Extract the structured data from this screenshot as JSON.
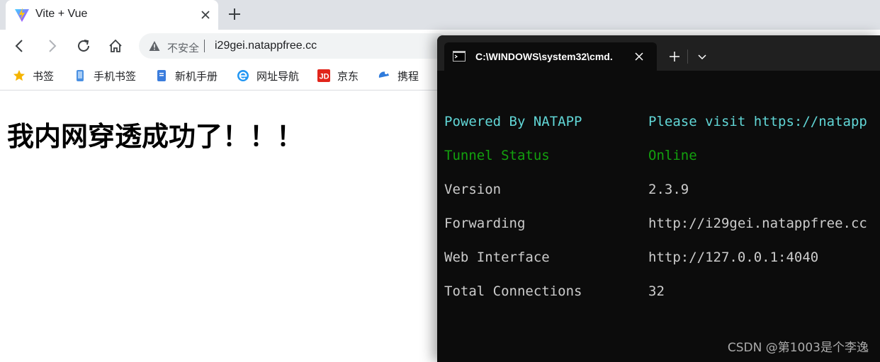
{
  "browser": {
    "tab": {
      "title": "Vite + Vue",
      "favicon": "vite-logo-icon",
      "close_icon": "close-icon"
    },
    "new_tab_icon": "plus-icon",
    "toolbar": {
      "back_icon": "back-arrow-icon",
      "forward_icon": "forward-arrow-icon",
      "reload_icon": "reload-icon",
      "home_icon": "home-icon",
      "security_icon": "warning-triangle-icon",
      "security_label": "不安全",
      "url": "i29gei.natappfree.cc"
    },
    "bookmarks": [
      {
        "label": "书签",
        "icon": "star-icon"
      },
      {
        "label": "手机书签",
        "icon": "phone-icon"
      },
      {
        "label": "新机手册",
        "icon": "manual-icon"
      },
      {
        "label": "网址导航",
        "icon": "browser-e-icon"
      },
      {
        "label": "京东",
        "icon": "jd-icon"
      },
      {
        "label": "携程",
        "icon": "ctrip-icon"
      }
    ],
    "page": {
      "heading": "我内网穿透成功了！！！"
    }
  },
  "terminal": {
    "tab_title": "C:\\WINDOWS\\system32\\cmd.",
    "rows": [
      {
        "key": "Powered By NATAPP",
        "value": "Please visit https://natapp"
      },
      {
        "key": "Tunnel Status",
        "value": "Online"
      },
      {
        "key": "Version",
        "value": "2.3.9"
      },
      {
        "key": "Forwarding",
        "value": "http://i29gei.natappfree.cc"
      },
      {
        "key": "Web Interface",
        "value": "http://127.0.0.1:4040"
      },
      {
        "key": "Total Connections",
        "value": "32"
      }
    ]
  },
  "watermark": "CSDN @第1003是个李逸",
  "colors": {
    "cyan": "#61d6d6",
    "green": "#13a10e",
    "gray_text": "#cccccc",
    "terminal_bg": "#0c0c0c",
    "tabstrip_bg": "#dee1e6"
  }
}
